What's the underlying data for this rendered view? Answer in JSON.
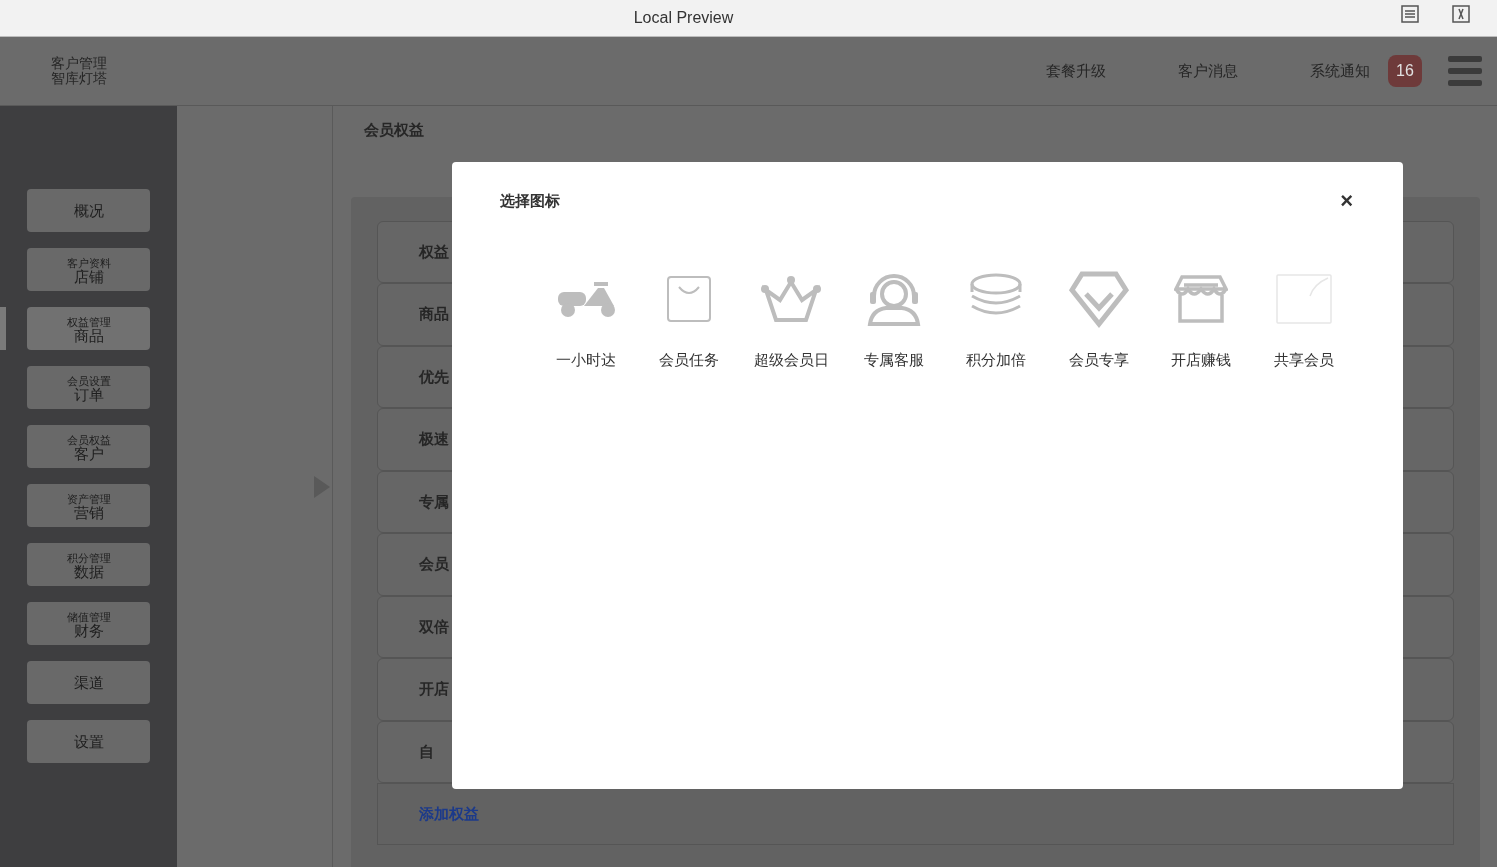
{
  "window": {
    "title": "Local Preview"
  },
  "header": {
    "brand": "智库灯塔",
    "subtitle": "客户管理",
    "links": [
      "套餐升级",
      "客户消息",
      "系统通知"
    ],
    "badge": "16"
  },
  "sidebar": {
    "items": [
      {
        "label": "概况",
        "selected": false
      },
      {
        "label": "店铺",
        "sublabel": "客户资料",
        "selected": false
      },
      {
        "label": "商品",
        "sublabel": "权益管理",
        "selected": true
      },
      {
        "label": "订单",
        "sublabel": "会员设置",
        "selected": false
      },
      {
        "label": "客户",
        "sublabel": "会员权益",
        "selected": false
      },
      {
        "label": "营销",
        "sublabel": "资产管理",
        "selected": false
      },
      {
        "label": "数据",
        "sublabel": "积分管理",
        "selected": false
      },
      {
        "label": "财务",
        "sublabel": "储值管理",
        "selected": false
      },
      {
        "label": "渠道",
        "selected": false
      },
      {
        "label": "设置",
        "selected": false
      }
    ]
  },
  "main": {
    "title": "会员权益",
    "rows": [
      "权益",
      "商品",
      "优先",
      "极速",
      "专属",
      "会员",
      "双倍",
      "开店",
      "自"
    ],
    "add_link": "添加权益"
  },
  "dialog": {
    "title": "选择图标",
    "close": "×",
    "icons": [
      {
        "kind": "scooter",
        "label": "一小时达"
      },
      {
        "kind": "bag",
        "label": "会员任务"
      },
      {
        "kind": "crown",
        "label": "超级会员日"
      },
      {
        "kind": "headset",
        "label": "专属客服"
      },
      {
        "kind": "coins",
        "label": "积分加倍"
      },
      {
        "kind": "diamond",
        "label": "会员专享"
      },
      {
        "kind": "shop",
        "label": "开店赚钱"
      },
      {
        "kind": "blank",
        "label": "共享会员"
      }
    ]
  }
}
